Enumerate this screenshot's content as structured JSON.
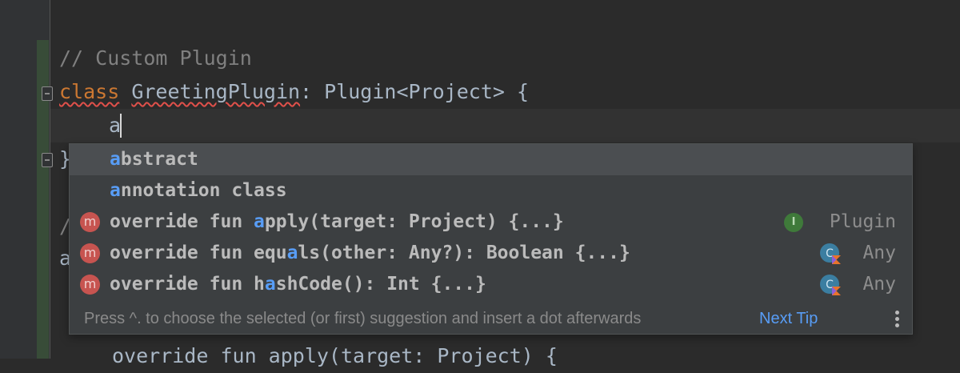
{
  "editor": {
    "comment": "// Custom Plugin",
    "class_keyword": "class",
    "class_name": "GreetingPlugin",
    "class_rest": ": Plugin<Project> {",
    "typed_text": "a",
    "closing_brace": "}",
    "hidden_line_1": "/",
    "hidden_line_2": "a",
    "bottom_partial": "override fun apply(target: Project) {"
  },
  "completion": {
    "items": [
      {
        "match": "a",
        "rest_bold": "bstract",
        "rest": "",
        "icon": "",
        "type": ""
      },
      {
        "match": "a",
        "rest_bold": "nnotation class",
        "rest": "",
        "icon": "",
        "type": ""
      },
      {
        "prefix": "override fun ",
        "match": "a",
        "rest_bold": "pply(target: Project) {...}",
        "icon": "method-icon",
        "type_icon": "interface-icon",
        "type": "Plugin"
      },
      {
        "prefix": "override fun equ",
        "match": "a",
        "rest_bold": "ls(other: Any?): Boolean {...}",
        "icon": "method-icon",
        "type_icon": "kotlin-class-icon",
        "type": "Any"
      },
      {
        "prefix": "override fun h",
        "match": "a",
        "rest_bold": "shCode(): Int {...}",
        "icon": "method-icon",
        "type_icon": "kotlin-class-icon",
        "type": "Any"
      }
    ],
    "method_badge": "m",
    "interface_badge": "I",
    "footer_text": "Press ^. to choose the selected (or first) suggestion and insert a dot afterwards",
    "next_tip": "Next Tip"
  },
  "colors": {
    "keyword": "#cc7832",
    "highlight": "#589df6",
    "method_badge": "#c75450",
    "interface_badge": "#3f7a3a"
  }
}
